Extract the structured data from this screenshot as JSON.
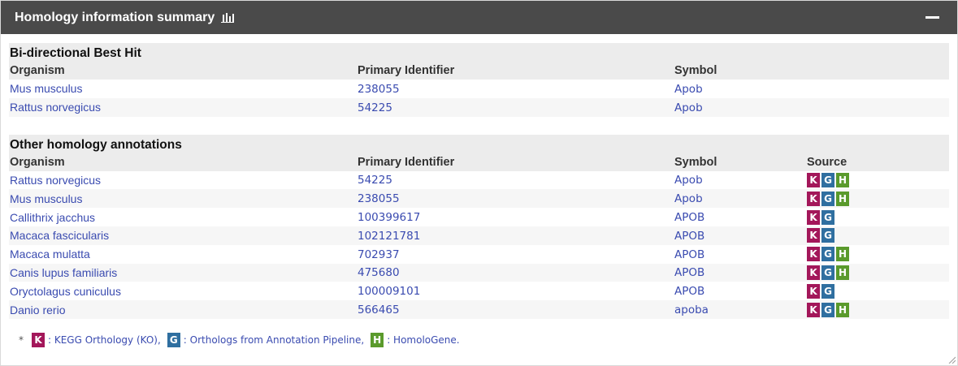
{
  "header": {
    "title": "Homology information summary"
  },
  "best_hit": {
    "title": "Bi-directional Best Hit",
    "columns": [
      "Organism",
      "Primary Identifier",
      "Symbol"
    ],
    "rows": [
      {
        "organism": "Mus musculus",
        "id": "238055",
        "symbol": "Apob"
      },
      {
        "organism": "Rattus norvegicus",
        "id": "54225",
        "symbol": "Apob"
      }
    ]
  },
  "other": {
    "title": "Other homology annotations",
    "columns": [
      "Organism",
      "Primary Identifier",
      "Symbol",
      "Source"
    ],
    "rows": [
      {
        "organism": "Rattus norvegicus",
        "id": "54225",
        "symbol": "Apob",
        "sources": [
          "K",
          "G",
          "H"
        ]
      },
      {
        "organism": "Mus musculus",
        "id": "238055",
        "symbol": "Apob",
        "sources": [
          "K",
          "G",
          "H"
        ]
      },
      {
        "organism": "Callithrix jacchus",
        "id": "100399617",
        "symbol": "APOB",
        "sources": [
          "K",
          "G"
        ]
      },
      {
        "organism": "Macaca fascicularis",
        "id": "102121781",
        "symbol": "APOB",
        "sources": [
          "K",
          "G"
        ]
      },
      {
        "organism": "Macaca mulatta",
        "id": "702937",
        "symbol": "APOB",
        "sources": [
          "K",
          "G",
          "H"
        ]
      },
      {
        "organism": "Canis lupus familiaris",
        "id": "475680",
        "symbol": "APOB",
        "sources": [
          "K",
          "G",
          "H"
        ]
      },
      {
        "organism": "Oryctolagus cuniculus",
        "id": "100009101",
        "symbol": "APOB",
        "sources": [
          "K",
          "G"
        ]
      },
      {
        "organism": "Danio rerio",
        "id": "566465",
        "symbol": "apoba",
        "sources": [
          "K",
          "G",
          "H"
        ]
      }
    ]
  },
  "legend": {
    "star": "*",
    "k_badge": "K",
    "k_text": ": KEGG Orthology (KO),",
    "g_badge": "G",
    "g_text": ": Orthologs from Annotation Pipeline,",
    "h_badge": "H",
    "h_text": ": HomoloGene."
  },
  "colors": {
    "k": "#a3175a",
    "g": "#2f6fa0",
    "h": "#5a9a2c",
    "header_bg": "#4a4a4a",
    "link": "#3a4bb0"
  }
}
